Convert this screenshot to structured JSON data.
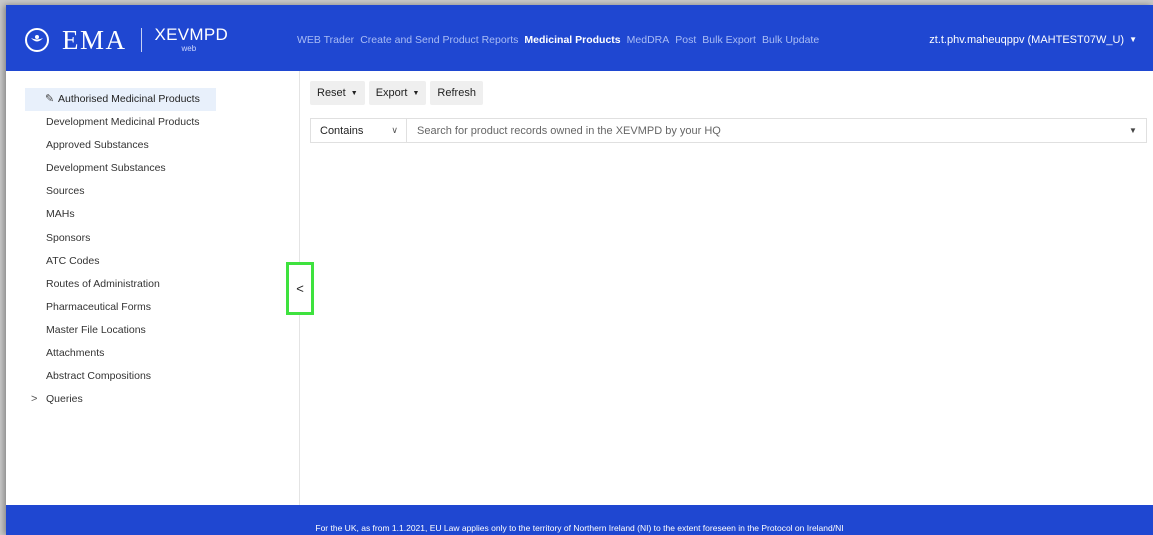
{
  "header": {
    "logo_text": "EMA",
    "app_name": "XEVMPD",
    "app_sub": "web",
    "nav": [
      {
        "label": "WEB Trader",
        "active": false
      },
      {
        "label": "Create and Send Product Reports",
        "active": false
      },
      {
        "label": "Medicinal Products",
        "active": true
      },
      {
        "label": "MedDRA",
        "active": false
      },
      {
        "label": "Post",
        "active": false
      },
      {
        "label": "Bulk Export",
        "active": false
      },
      {
        "label": "Bulk Update",
        "active": false
      }
    ],
    "user": "zt.t.phv.maheuqppv (MAHTEST07W_U)"
  },
  "sidebar": {
    "items": [
      {
        "label": "Authorised Medicinal Products"
      },
      {
        "label": "Development Medicinal Products"
      },
      {
        "label": "Approved Substances"
      },
      {
        "label": "Development Substances"
      },
      {
        "label": "Sources"
      },
      {
        "label": "MAHs"
      },
      {
        "label": "Sponsors"
      },
      {
        "label": "ATC Codes"
      },
      {
        "label": "Routes of Administration"
      },
      {
        "label": "Pharmaceutical Forms"
      },
      {
        "label": "Master File Locations"
      },
      {
        "label": "Attachments"
      },
      {
        "label": "Abstract Compositions"
      },
      {
        "label": "Queries"
      }
    ],
    "collapse_glyph": "<"
  },
  "toolbar": {
    "reset_label": "Reset",
    "export_label": "Export",
    "refresh_label": "Refresh"
  },
  "search": {
    "mode": "Contains",
    "placeholder": "Search for product records owned in the XEVMPD by your HQ"
  },
  "footer": {
    "text": "For the UK, as from 1.1.2021, EU Law applies only to the territory of Northern Ireland (NI) to the extent foreseen in the Protocol on Ireland/NI"
  },
  "colors": {
    "brand": "#1f47d1",
    "active_item_bg": "#e8f0fb",
    "highlight": "#3ee23e"
  }
}
